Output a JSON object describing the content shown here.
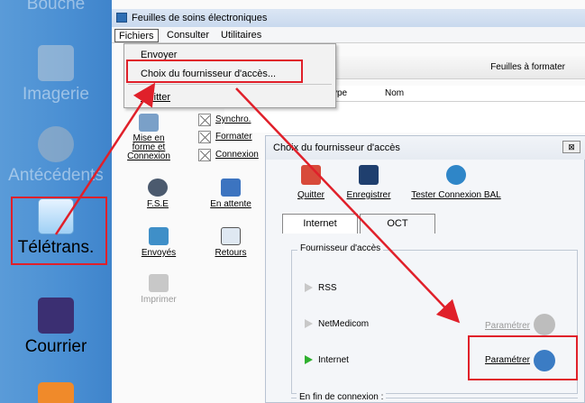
{
  "sidebar": {
    "items": [
      {
        "label": "Imagerie",
        "icon": "tooth-xray-icon",
        "faded": true
      },
      {
        "label": "Antécédents",
        "icon": "patient-history-icon",
        "faded": true
      },
      {
        "label": "Télétrans.",
        "icon": "teletransmission-cloud-icon",
        "faded": false
      },
      {
        "label": "Courrier",
        "icon": "pen-letter-icon",
        "faded": false
      },
      {
        "label": "",
        "icon": "calendar-icon",
        "faded": false
      }
    ],
    "top_partial_label": "Bouche"
  },
  "window": {
    "title": "Feuilles de soins électroniques",
    "menus": [
      "Fichiers",
      "Consulter",
      "Utilitaires"
    ],
    "dropdown": {
      "items": [
        "Envoyer",
        "Choix du fournisseur d'accès...",
        "Quitter"
      ]
    },
    "table": {
      "header_right": "Feuilles à formater",
      "col_type": "ype",
      "col_nom": "Nom"
    },
    "tools": {
      "mise_en_forme": "Mise en forme et Connexion",
      "synchro": "Synchro.",
      "formater": "Formater",
      "connexion": "Connexion",
      "fse": "F.S.E",
      "en_attente": "En attente",
      "envoyes": "Envoyés",
      "retours": "Retours",
      "imprimer": "Imprimer"
    }
  },
  "dialog": {
    "title": "Choix du fournisseur d'accès",
    "close": "⊠",
    "buttons": [
      "Quitter",
      "Enregistrer",
      "Tester Connexion BAL"
    ],
    "tabs": [
      "Internet",
      "OCT"
    ],
    "group_title": "Fournisseur d'accès",
    "providers": [
      "RSS",
      "NetMedicom",
      "Internet"
    ],
    "param_label": "Paramétrer",
    "group2_title": "En fin de connexion :"
  },
  "colors": {
    "sidebar_blue": "#4a8fd3",
    "annotation_red": "#e0202a",
    "active_green": "#2fb02f"
  }
}
